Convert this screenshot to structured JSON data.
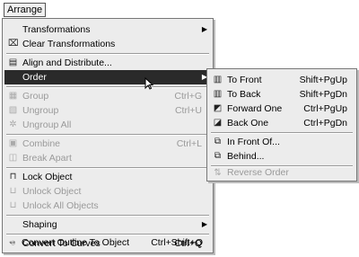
{
  "menubar": {
    "title": "Arrange"
  },
  "menu": {
    "items": [
      {
        "label": "Transformations",
        "shortcut": "",
        "icon": "",
        "submenu": true
      },
      {
        "label": "Clear Transformations",
        "shortcut": "",
        "icon": "clear-transform-icon"
      },
      {
        "label": "Align and Distribute...",
        "shortcut": "",
        "icon": "align-icon"
      },
      {
        "label": "Order",
        "shortcut": "",
        "icon": "",
        "submenu": true
      },
      {
        "label": "Group",
        "shortcut": "Ctrl+G",
        "icon": "group-icon"
      },
      {
        "label": "Ungroup",
        "shortcut": "Ctrl+U",
        "icon": "ungroup-icon"
      },
      {
        "label": "Ungroup All",
        "shortcut": "",
        "icon": "ungroup-all-icon"
      },
      {
        "label": "Combine",
        "shortcut": "Ctrl+L",
        "icon": "combine-icon"
      },
      {
        "label": "Break Apart",
        "shortcut": "",
        "icon": "break-apart-icon"
      },
      {
        "label": "Lock Object",
        "shortcut": "",
        "icon": "lock-icon"
      },
      {
        "label": "Unlock Object",
        "shortcut": "",
        "icon": "unlock-icon"
      },
      {
        "label": "Unlock All Objects",
        "shortcut": "",
        "icon": "unlock-all-icon"
      },
      {
        "label": "Shaping",
        "shortcut": "",
        "icon": "",
        "submenu": true
      },
      {
        "label": "Convert To Curves",
        "shortcut": "Ctrl+Q",
        "icon": "convert-curves-icon"
      },
      {
        "label": "Convert Outline To Object",
        "shortcut": "Ctrl+Shift+Q",
        "icon": "convert-outline-icon"
      }
    ]
  },
  "submenu": {
    "items": [
      {
        "label": "To Front",
        "shortcut": "Shift+PgUp",
        "icon": "to-front-icon"
      },
      {
        "label": "To Back",
        "shortcut": "Shift+PgDn",
        "icon": "to-back-icon"
      },
      {
        "label": "Forward One",
        "shortcut": "Ctrl+PgUp",
        "icon": "forward-one-icon"
      },
      {
        "label": "Back One",
        "shortcut": "Ctrl+PgDn",
        "icon": "back-one-icon"
      },
      {
        "label": "In Front Of...",
        "shortcut": "",
        "icon": "in-front-of-icon"
      },
      {
        "label": "Behind...",
        "shortcut": "",
        "icon": "behind-icon"
      },
      {
        "label": "Reverse Order",
        "shortcut": "",
        "icon": "reverse-order-icon"
      }
    ]
  }
}
